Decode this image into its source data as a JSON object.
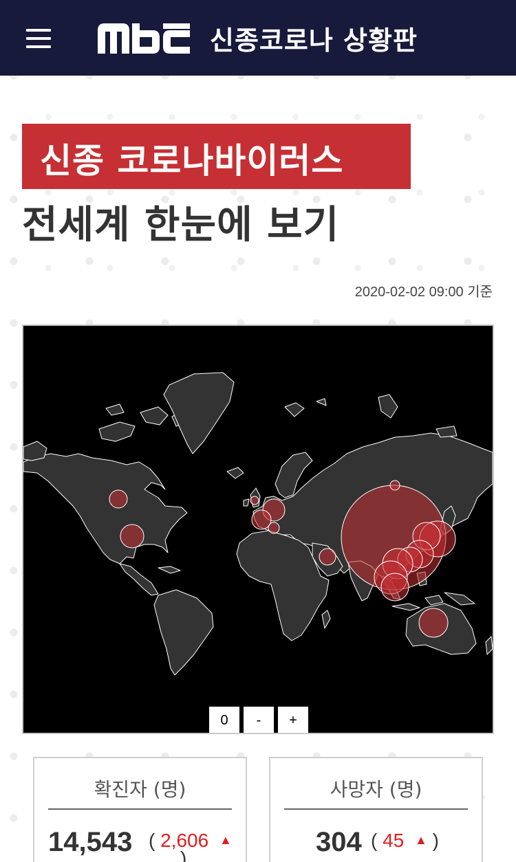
{
  "header": {
    "logo_text": "MBC",
    "title": "신종코로나 상황판"
  },
  "hero": {
    "banner": "신종 코로나바이러스",
    "subtitle": "전세계 한눈에 보기"
  },
  "timestamp": "2020-02-02 09:00 기준",
  "map": {
    "zoom_controls": [
      "0",
      "-",
      "+"
    ],
    "colors": {
      "ocean": "#000000",
      "land": "#333333",
      "border": "#ffffff",
      "case_bubble": "#d0282d"
    }
  },
  "stats": {
    "confirmed": {
      "label": "확진자 (명)",
      "value": "14,543",
      "delta": "2,606",
      "open_paren": "(",
      "close_paren": ")"
    },
    "deaths": {
      "label": "사망자 (명)",
      "value": "304",
      "delta": "45",
      "open_paren": "(",
      "close_paren": ")"
    }
  }
}
